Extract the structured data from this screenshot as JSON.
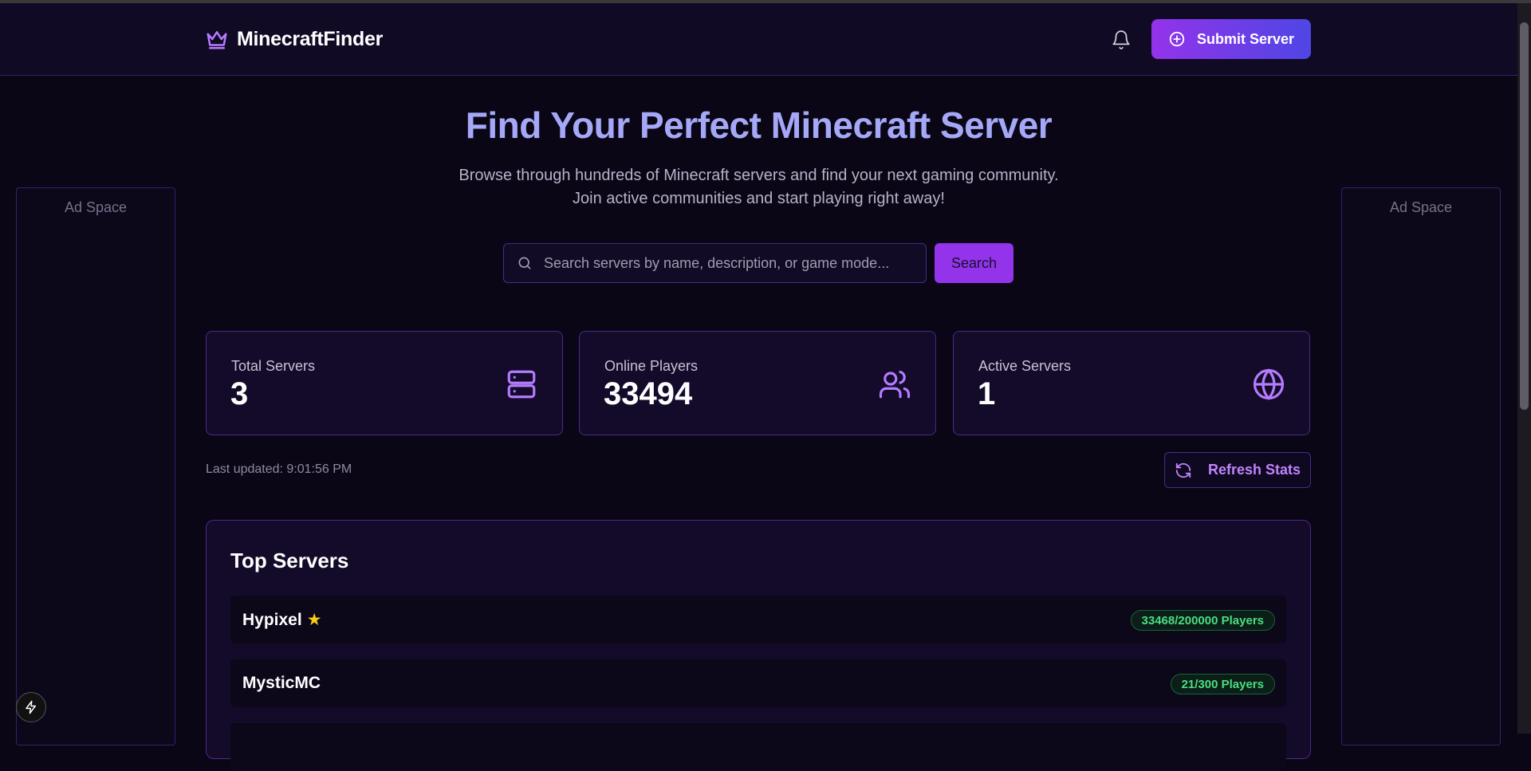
{
  "header": {
    "logo_text": "MinecraftFinder",
    "submit_label": "Submit Server",
    "bell_icon": "bell-icon",
    "crown_icon": "crown-icon"
  },
  "ads": {
    "left_label": "Ad Space",
    "right_label": "Ad Space"
  },
  "hero": {
    "title": "Find Your Perfect Minecraft Server",
    "subtitle_line1": "Browse through hundreds of Minecraft servers and find your next gaming community.",
    "subtitle_line2": "Join active communities and start playing right away!"
  },
  "search": {
    "placeholder": "Search servers by name, description, or game mode...",
    "value": "",
    "button_label": "Search"
  },
  "stats": [
    {
      "label": "Total Servers",
      "value": "3",
      "icon": "server-icon"
    },
    {
      "label": "Online Players",
      "value": "33494",
      "icon": "users-icon"
    },
    {
      "label": "Active Servers",
      "value": "1",
      "icon": "globe-icon"
    }
  ],
  "status": {
    "last_updated": "Last updated: 9:01:56 PM",
    "refresh_label": "Refresh Stats"
  },
  "top_servers": {
    "title": "Top Servers",
    "items": [
      {
        "name": "Hypixel",
        "featured": true,
        "players": "33468/200000 Players"
      },
      {
        "name": "MysticMC",
        "featured": false,
        "players": "21/300 Players"
      }
    ]
  },
  "colors": {
    "accent": "#9333ea",
    "accent_gradient_end": "#4f46e5",
    "hero_title": "#a5a8f7",
    "badge_green": "#4ade80",
    "background": "#0a0616"
  }
}
